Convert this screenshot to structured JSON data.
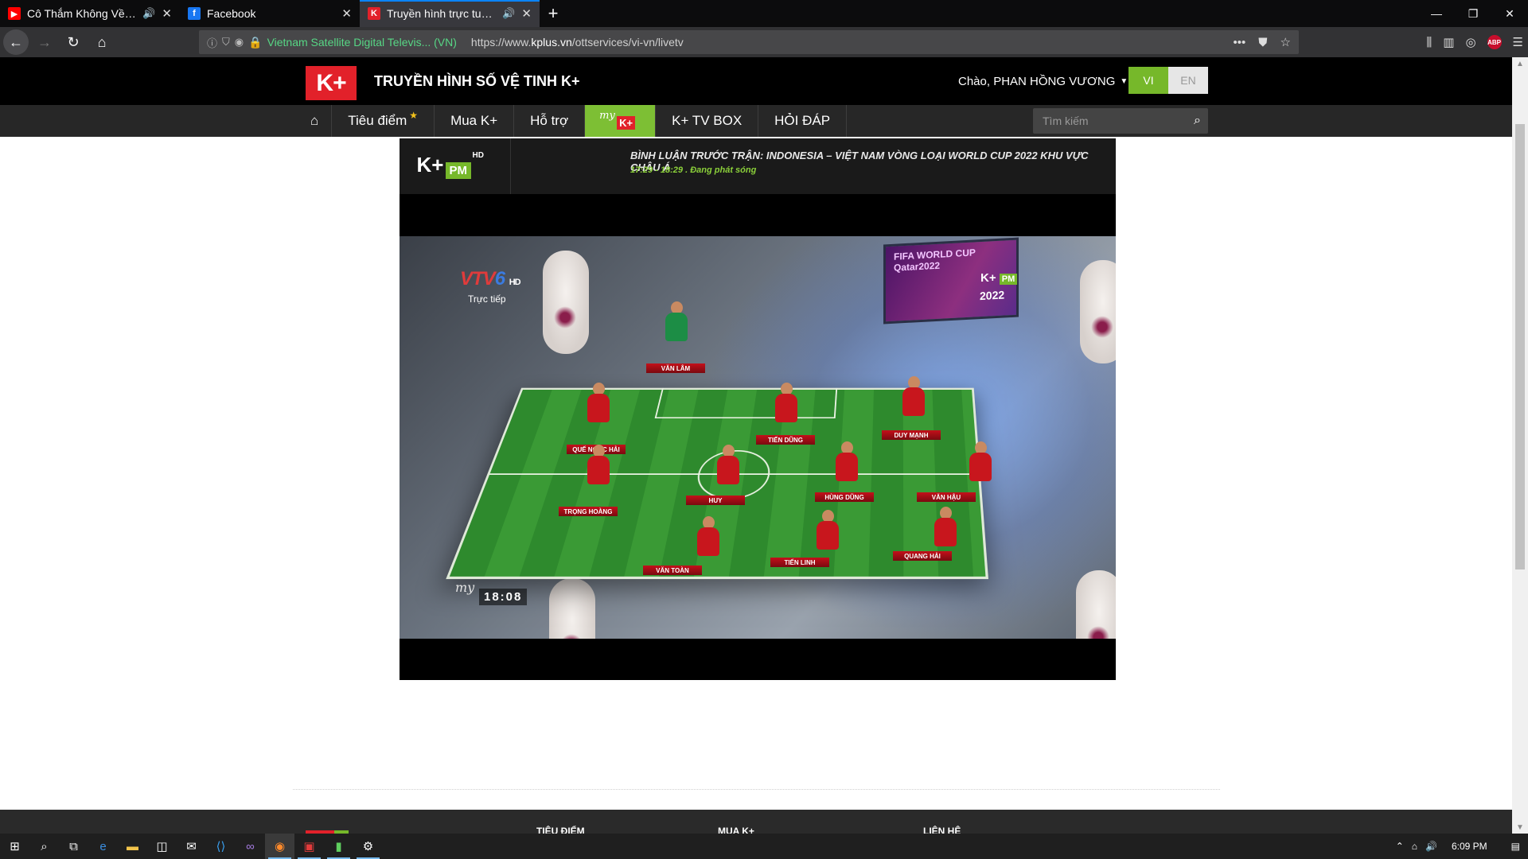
{
  "browser": {
    "tabs": [
      {
        "title": "Cô Thắm Không Về (DinhLo",
        "favicon": "youtube-icon",
        "favicon_color": "#ff0000",
        "audio": true
      },
      {
        "title": "Facebook",
        "favicon": "facebook-icon",
        "favicon_color": "#1877f2",
        "audio": false
      },
      {
        "title": "Truyền hình trực tuyến - my",
        "favicon": "kplus-icon",
        "favicon_color": "#e2212a",
        "audio": true,
        "active": true
      }
    ],
    "security_label": "Vietnam Satellite Digital Televis... (VN)",
    "url_prefix": "https://www.",
    "url_domain": "kplus.vn",
    "url_path": "/ottservices/vi-vn/livetv"
  },
  "site": {
    "logo_text": "K+",
    "title": "TRUYỀN HÌNH SỐ VỆ TINH K+",
    "greeting": "Chào, PHAN HỒNG VƯƠNG",
    "lang_vi": "VI",
    "lang_en": "EN",
    "menu": {
      "focus": "Tiêu điểm",
      "buy": "Mua K+",
      "support": "Hỗ trợ",
      "my_prefix": "my",
      "my_logo": "K+",
      "tvbox": "K+ TV BOX",
      "faq": "HỎI ĐÁP"
    },
    "search_placeholder": "Tìm kiếm"
  },
  "player": {
    "channel_logo": "K+",
    "channel_suffix": "PM",
    "channel_hd": "HD",
    "program_title": "BÌNH LUẬN TRƯỚC TRẬN: INDONESIA – VIỆT NAM VÒNG LOẠI WORLD CUP 2022 KHU VỰC CHÂU Á",
    "program_time": "17:29 - 18:29 . Đang phát sóng",
    "video": {
      "broadcaster_a": "VTV",
      "broadcaster_b": "6",
      "broadcaster_hd": "HD",
      "live_label": "Trực tiếp",
      "screen_text": "FIFA WORLD CUP Qatar2022",
      "screen_year": "2022",
      "watermark": "K+",
      "watermark_pm": "PM",
      "clock": "18:08",
      "my_watermark": "my",
      "players": [
        "VĂN LÂM",
        "QUẾ NGỌC HẢI",
        "TIẾN DŨNG",
        "DUY MẠNH",
        "TRỌNG HOÀNG",
        "HUY",
        "HÙNG DŨNG",
        "VĂN HẬU",
        "VĂN TOÀN",
        "TIẾN LINH",
        "QUANG HẢI"
      ]
    }
  },
  "footer": {
    "col1": "TIÊU ĐIỂM",
    "col2": "MUA K+",
    "col3": "LIÊN HỆ"
  },
  "taskbar": {
    "time": "6:09 PM"
  }
}
